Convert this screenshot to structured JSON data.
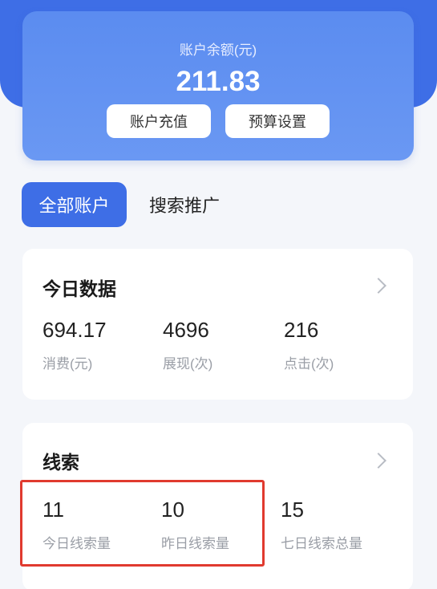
{
  "balance": {
    "label": "账户余额(元)",
    "value": "211.83",
    "recharge_label": "账户充值",
    "budget_label": "预算设置"
  },
  "tabs": [
    {
      "label": "全部账户",
      "active": true
    },
    {
      "label": "搜索推广",
      "active": false
    }
  ],
  "today": {
    "title": "今日数据",
    "stats": [
      {
        "value": "694.17",
        "label": "消费(元)"
      },
      {
        "value": "4696",
        "label": "展现(次)"
      },
      {
        "value": "216",
        "label": "点击(次)"
      }
    ]
  },
  "leads": {
    "title": "线索",
    "stats": [
      {
        "value": "11",
        "label": "今日线索量"
      },
      {
        "value": "10",
        "label": "昨日线索量"
      },
      {
        "value": "15",
        "label": "七日线索总量"
      }
    ]
  },
  "colors": {
    "primary": "#3e6ee6",
    "card_gradient": "#5b8cf0",
    "highlight": "#e03a2f",
    "muted_text": "#9a9ea6"
  },
  "icons": {
    "today_chevron": "chevron-right-icon",
    "leads_chevron": "chevron-right-icon"
  }
}
